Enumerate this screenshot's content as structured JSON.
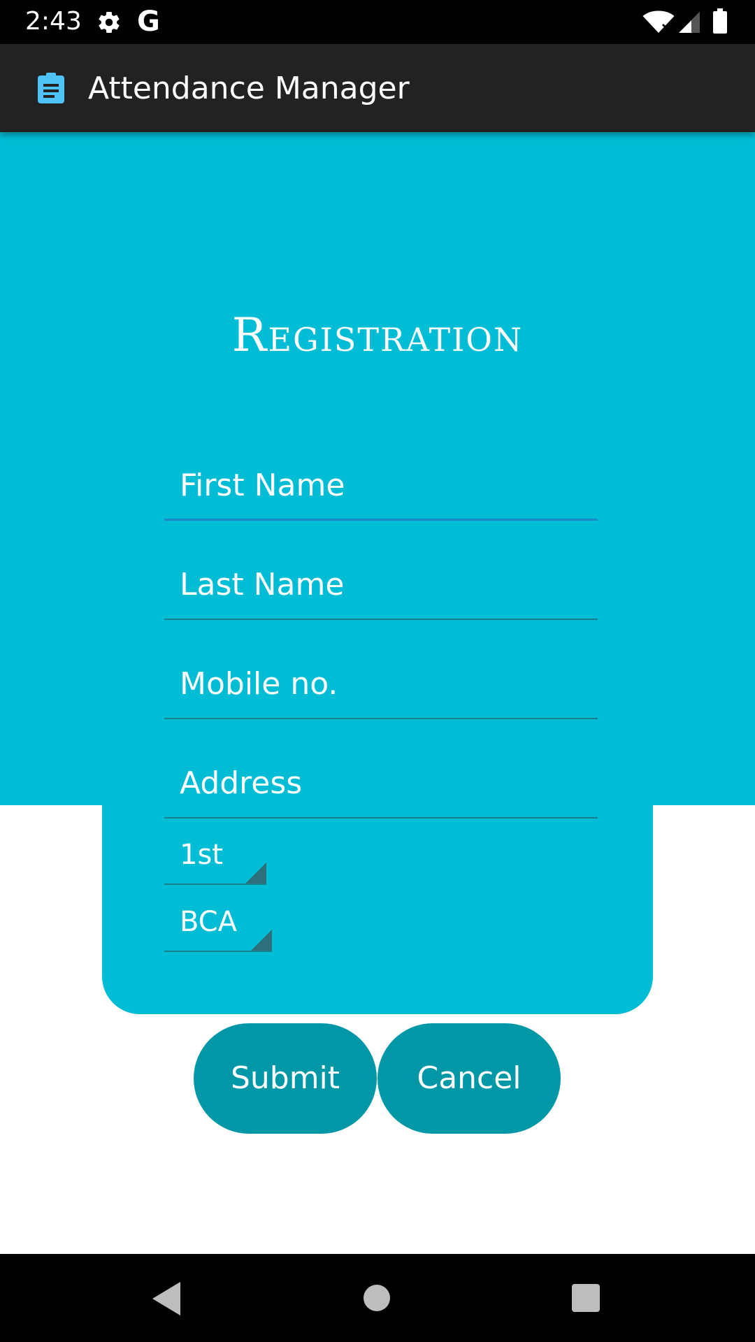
{
  "status_bar": {
    "time": "2:43",
    "settings_icon": "gear-icon",
    "google_icon": "G",
    "wifi_icon": "wifi-icon",
    "signal_icon": "signal-icon",
    "battery_icon": "battery-icon"
  },
  "app_bar": {
    "icon": "clipboard-icon",
    "title": "Attendance Manager"
  },
  "form": {
    "title": "Registration",
    "first_name_placeholder": "First Name",
    "last_name_placeholder": "Last Name",
    "mobile_placeholder": "Mobile no.",
    "address_placeholder": "Address",
    "year_selected": "1st",
    "course_selected": "BCA"
  },
  "buttons": {
    "submit_label": "Submit",
    "cancel_label": "Cancel"
  },
  "nav_bar": {
    "back_icon": "back-icon",
    "home_icon": "home-icon",
    "recents_icon": "recents-icon"
  },
  "colors": {
    "accent": "#00bcd4",
    "button": "#0097a7",
    "app_bar": "#222222",
    "focus_underline": "#1f86c9"
  }
}
